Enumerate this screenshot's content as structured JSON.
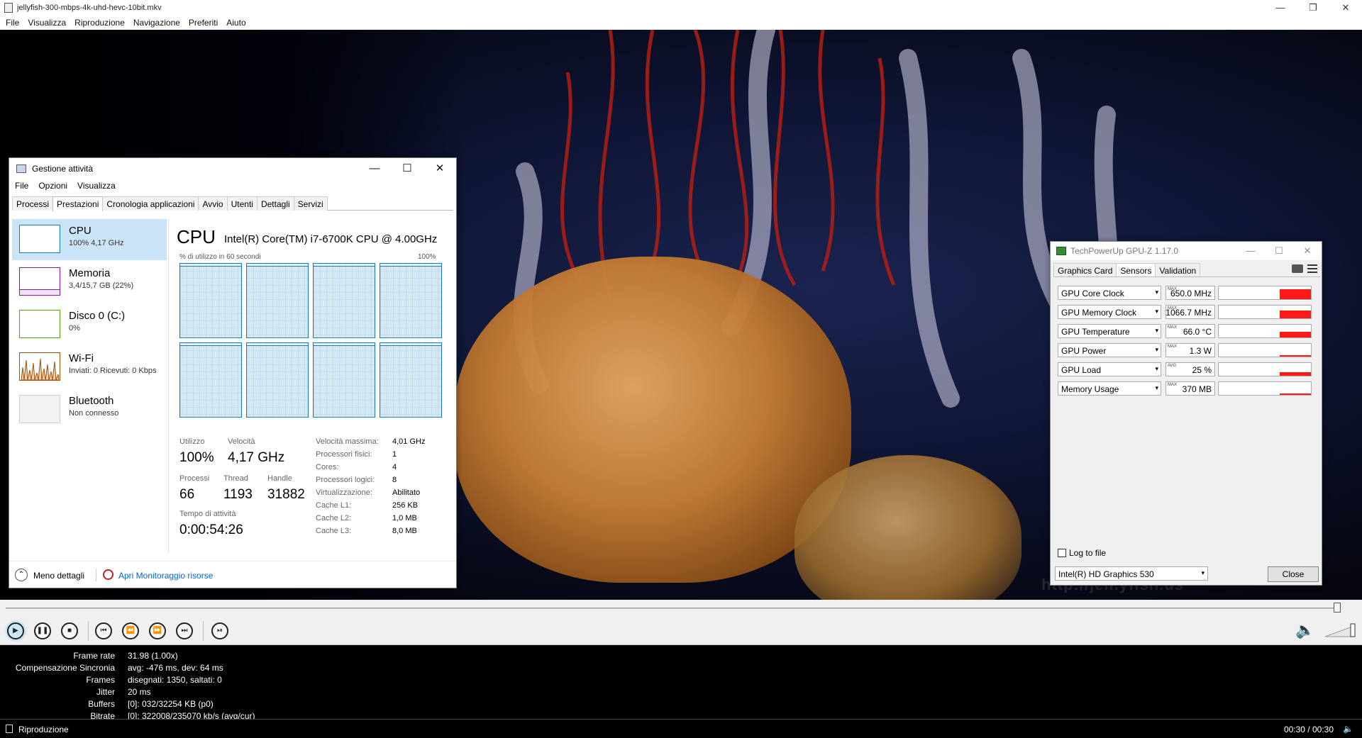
{
  "player": {
    "window_title": "jellyfish-300-mbps-4k-uhd-hevc-10bit.mkv",
    "window_controls": {
      "minimize": "—",
      "restore": "❐",
      "close": "✕"
    },
    "menu": [
      "File",
      "Visualizza",
      "Riproduzione",
      "Navigazione",
      "Preferiti",
      "Aiuto"
    ],
    "watermark": "http://jell.yfish.us",
    "seek_progress": 1.0,
    "controls": {
      "play": "▶",
      "pause": "❚❚",
      "stop": "■",
      "prev": "⏮",
      "rewind": "⏪",
      "forward": "⏩",
      "next": "⏭",
      "frame_step": "⏯"
    },
    "speaker_icon": "🔈",
    "stats": [
      {
        "label": "Frame rate",
        "value": "31.98 (1.00x)"
      },
      {
        "label": "Compensazione Sincronia",
        "value": "avg: -476 ms, dev: 64 ms"
      },
      {
        "label": "Frames",
        "value": "disegnati: 1350, saltati: 0"
      },
      {
        "label": "Jitter",
        "value": "20 ms"
      },
      {
        "label": "Buffers",
        "value": "[0]: 032/32254 KB (p0)"
      },
      {
        "label": "Bitrate",
        "value": "[0]: 322008/235070 kb/s (avg/cur)"
      }
    ],
    "status": {
      "state": "Riproduzione",
      "time": "00:30 / 00:30",
      "volume_icon": "🔈"
    }
  },
  "taskmgr": {
    "title": "Gestione attività",
    "window_controls": {
      "minimize": "—",
      "maximize": "☐",
      "close": "✕"
    },
    "menu": [
      "File",
      "Opzioni",
      "Visualizza"
    ],
    "tabs": [
      "Processi",
      "Prestazioni",
      "Cronologia applicazioni",
      "Avvio",
      "Utenti",
      "Dettagli",
      "Servizi"
    ],
    "active_tab": "Prestazioni",
    "sidebar": [
      {
        "name": "CPU",
        "sub": "100% 4,17 GHz",
        "color": "#117dbb"
      },
      {
        "name": "Memoria",
        "sub": "3,4/15,7 GB (22%)",
        "color": "#8b12ae"
      },
      {
        "name": "Disco 0 (C:)",
        "sub": "0%",
        "color": "#4da60c"
      },
      {
        "name": "Wi-Fi",
        "sub": "Inviati: 0 Ricevuti: 0 Kbps",
        "color": "#a74f01"
      },
      {
        "name": "Bluetooth",
        "sub": "Non connesso",
        "color": "#999999"
      }
    ],
    "heading": "CPU",
    "processor": "Intel(R) Core(TM) i7-6700K CPU @ 4.00GHz",
    "graph_label": "% di utilizzo in 60 secondi",
    "graph_max": "100%",
    "core_load": [
      0.97,
      0.97,
      0.97,
      0.97,
      0.97,
      0.97,
      0.97,
      0.97
    ],
    "stats": {
      "utilizzo_label": "Utilizzo",
      "utilizzo": "100%",
      "velocita_label": "Velocità",
      "velocita": "4,17 GHz",
      "processi_label": "Processi",
      "processi": "66",
      "thread_label": "Thread",
      "thread": "1193",
      "handle_label": "Handle",
      "handle": "31882",
      "uptime_label": "Tempo di attività",
      "uptime": "0:00:54:26"
    },
    "details": [
      {
        "k": "Velocità massima:",
        "v": "4,01 GHz"
      },
      {
        "k": "Processori fisici:",
        "v": "1"
      },
      {
        "k": "Cores:",
        "v": "4"
      },
      {
        "k": "Processori logici:",
        "v": "8"
      },
      {
        "k": "Virtualizzazione:",
        "v": "Abilitato"
      },
      {
        "k": "Cache L1:",
        "v": "256 KB"
      },
      {
        "k": "Cache L2:",
        "v": "1,0 MB"
      },
      {
        "k": "Cache L3:",
        "v": "8,0 MB"
      }
    ],
    "footer": {
      "less": "Meno dettagli",
      "chevron": "⌃",
      "link": "Apri Monitoraggio risorse"
    }
  },
  "gpuz": {
    "title": "TechPowerUp GPU-Z 1.17.0",
    "window_controls": {
      "minimize": "—",
      "maximize": "☐",
      "close": "✕"
    },
    "tabs": [
      "Graphics Card",
      "Sensors",
      "Validation"
    ],
    "active_tab": "Sensors",
    "sensors": [
      {
        "name": "GPU Core Clock",
        "tag": "MAX",
        "value": "650.0 MHz",
        "level": 0.8
      },
      {
        "name": "GPU Memory Clock",
        "tag": "MAX",
        "value": "1066.7 MHz",
        "level": 0.6
      },
      {
        "name": "GPU Temperature",
        "tag": "MAX",
        "value": "66.0 °C",
        "level": 0.45
      },
      {
        "name": "GPU Power",
        "tag": "MAX",
        "value": "1.3 W",
        "level": 0.08
      },
      {
        "name": "GPU Load",
        "tag": "AVG",
        "value": "25 %",
        "level": 0.3
      },
      {
        "name": "Memory Usage",
        "tag": "MAX",
        "value": "370 MB",
        "level": 0.08
      }
    ],
    "arrow": "▾",
    "log_to_file": "Log to file",
    "adapter": "Intel(R) HD Graphics 530",
    "close_label": "Close"
  }
}
